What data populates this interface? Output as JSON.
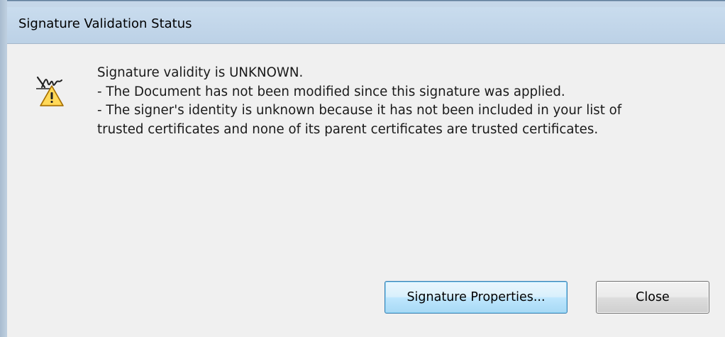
{
  "window": {
    "title": "Signature Validation Status"
  },
  "message": {
    "lines": [
      "Signature validity is UNKNOWN.",
      "- The Document has not been modified since this signature was applied.",
      "- The signer's identity is unknown because it has not been included in your list of",
      "trusted certificates and none of its parent certificates are trusted certificates."
    ]
  },
  "icons": {
    "status": "signature-warning-icon"
  },
  "buttons": {
    "properties_label": "Signature Properties...",
    "close_label": "Close"
  },
  "colors": {
    "titlebar": "#c9dcee",
    "dialog_background": "#f0f0f0",
    "default_button_border": "#3c7fb1"
  }
}
